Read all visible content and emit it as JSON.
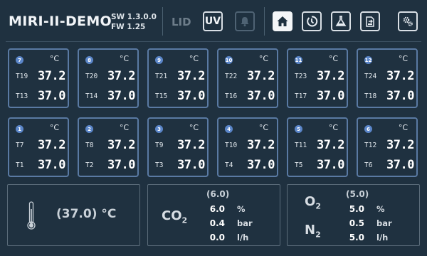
{
  "header": {
    "title": "MIRI-II-DEMO",
    "sw_version": "SW 1.3.0.0",
    "fw_version": "FW 1.25",
    "lid_label": "LID",
    "uv_label": "UV",
    "icons": [
      "bell-icon",
      "home-icon",
      "timer-icon",
      "flask-icon",
      "export-icon",
      "settings-icon"
    ]
  },
  "chambers": [
    {
      "id": "7",
      "unit": "°C",
      "t_top": "T19",
      "v_top": "37.2",
      "t_bot": "T13",
      "v_bot": "37.0"
    },
    {
      "id": "8",
      "unit": "°C",
      "t_top": "T20",
      "v_top": "37.2",
      "t_bot": "T14",
      "v_bot": "37.0"
    },
    {
      "id": "9",
      "unit": "°C",
      "t_top": "T21",
      "v_top": "37.2",
      "t_bot": "T15",
      "v_bot": "37.0"
    },
    {
      "id": "10",
      "unit": "°C",
      "t_top": "T22",
      "v_top": "37.2",
      "t_bot": "T16",
      "v_bot": "37.0"
    },
    {
      "id": "11",
      "unit": "°C",
      "t_top": "T23",
      "v_top": "37.2",
      "t_bot": "T17",
      "v_bot": "37.0"
    },
    {
      "id": "12",
      "unit": "°C",
      "t_top": "T24",
      "v_top": "37.2",
      "t_bot": "T18",
      "v_bot": "37.0"
    },
    {
      "id": "1",
      "unit": "°C",
      "t_top": "T7",
      "v_top": "37.2",
      "t_bot": "T1",
      "v_bot": "37.0"
    },
    {
      "id": "2",
      "unit": "°C",
      "t_top": "T8",
      "v_top": "37.2",
      "t_bot": "T2",
      "v_bot": "37.0"
    },
    {
      "id": "3",
      "unit": "°C",
      "t_top": "T9",
      "v_top": "37.2",
      "t_bot": "T3",
      "v_bot": "37.0"
    },
    {
      "id": "4",
      "unit": "°C",
      "t_top": "T10",
      "v_top": "37.2",
      "t_bot": "T4",
      "v_bot": "37.0"
    },
    {
      "id": "5",
      "unit": "°C",
      "t_top": "T11",
      "v_top": "37.2",
      "t_bot": "T5",
      "v_bot": "37.0"
    },
    {
      "id": "6",
      "unit": "°C",
      "t_top": "T12",
      "v_top": "37.2",
      "t_bot": "T6",
      "v_bot": "37.0"
    }
  ],
  "temperature_panel": {
    "setpoint": "(37.0) °C"
  },
  "co2_panel": {
    "gas": "CO",
    "gas_sub": "2",
    "setpoint": "(6.0)",
    "rows": [
      {
        "value": "6.0",
        "unit": "%"
      },
      {
        "value": "0.4",
        "unit": "bar"
      },
      {
        "value": "0.0",
        "unit": "l/h"
      }
    ]
  },
  "o2_panel": {
    "gas_o": "O",
    "gas_o_sub": "2",
    "gas_n": "N",
    "gas_n_sub": "2",
    "setpoint": "(5.0)",
    "rows": [
      {
        "value": "5.0",
        "unit": "%"
      },
      {
        "value": "0.5",
        "unit": "bar"
      },
      {
        "value": "5.0",
        "unit": "l/h"
      }
    ]
  },
  "colors": {
    "background": "#1f3140",
    "chamber_border": "#5a7aa3",
    "badge": "#5b86c9"
  }
}
